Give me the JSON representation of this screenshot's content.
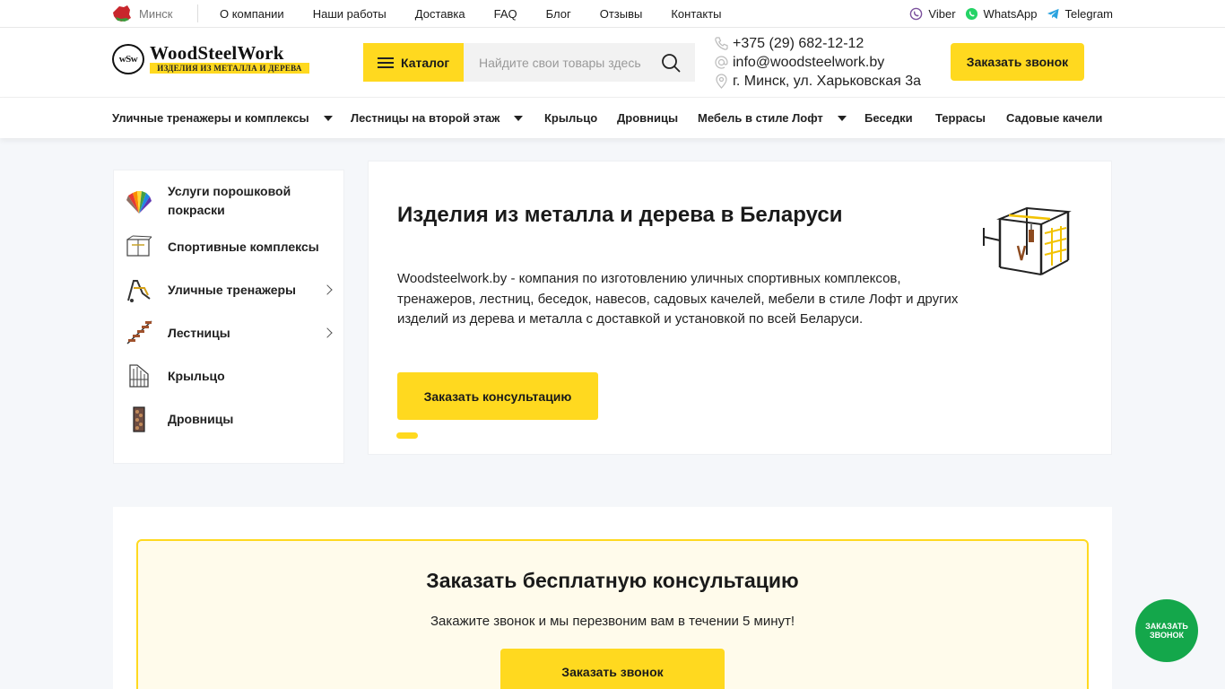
{
  "topbar": {
    "city": "Минск",
    "nav": [
      "О компании",
      "Наши работы",
      "Доставка",
      "FAQ",
      "Блог",
      "Отзывы",
      "Контакты"
    ],
    "messengers": [
      {
        "label": "Viber",
        "icon": "viber-icon",
        "color": "#7b519d"
      },
      {
        "label": "WhatsApp",
        "icon": "whatsapp-icon",
        "color": "#25d366"
      },
      {
        "label": "Telegram",
        "icon": "telegram-icon",
        "color": "#2aa3df"
      }
    ]
  },
  "header": {
    "logo_mark": "wSw",
    "logo_name": "WoodSteelWork",
    "logo_tagline": "ИЗДЕЛИЯ ИЗ МЕТАЛЛА И ДЕРЕВА",
    "catalog_label": "Каталог",
    "search_placeholder": "Найдите свои товары здесь",
    "phone": "+375 (29) 682-12-12",
    "email": "info@woodsteelwork.by",
    "address": "г. Минск, ул. Харьковская 3а",
    "call_button": "Заказать звонок"
  },
  "catnav": [
    {
      "label": "Уличные тренажеры и комплексы",
      "dropdown": true
    },
    {
      "label": "Лестницы на второй этаж",
      "dropdown": true
    },
    {
      "label": "Крыльцо",
      "dropdown": false
    },
    {
      "label": "Дровницы",
      "dropdown": false
    },
    {
      "label": "Мебель в стиле Лофт",
      "dropdown": true
    },
    {
      "label": "Беседки",
      "dropdown": false
    },
    {
      "label": "Террасы",
      "dropdown": false
    },
    {
      "label": "Садовые качели",
      "dropdown": false
    }
  ],
  "sidebar": [
    {
      "label": "Услуги порошковой покраски",
      "icon": "color-palette-icon",
      "submenu": false
    },
    {
      "label": "Спортивные комплексы",
      "icon": "sports-complex-icon",
      "submenu": false
    },
    {
      "label": "Уличные тренажеры",
      "icon": "outdoor-trainer-icon",
      "submenu": true
    },
    {
      "label": "Лестницы",
      "icon": "stairs-icon",
      "submenu": true
    },
    {
      "label": "Крыльцо",
      "icon": "porch-icon",
      "submenu": false
    },
    {
      "label": "Дровницы",
      "icon": "woodshed-icon",
      "submenu": false
    }
  ],
  "hero": {
    "title": "Изделия из металла и дерева в Беларуси",
    "text": "Woodsteelwork.by - компания по изготовлению уличных спортивных комплексов, тренажеров, лестниц, беседок, навесов, садовых качелей, мебели в стиле Лофт и других изделий из дерева и металла с доставкой и установкой по всей Беларуси.",
    "cta": "Заказать консультацию",
    "slides_total": 1,
    "slide_active": 1
  },
  "consult": {
    "title": "Заказать бесплатную консультацию",
    "subtitle": "Закажите звонок и мы перезвоним вам в течении 5 минут!",
    "button": "Заказать звонок"
  },
  "floating": {
    "label": "ЗАКАЗАТЬ ЗВОНОК"
  },
  "colors": {
    "accent": "#ffd91f",
    "green": "#14a74b",
    "page_bg": "#f5f7fa"
  }
}
